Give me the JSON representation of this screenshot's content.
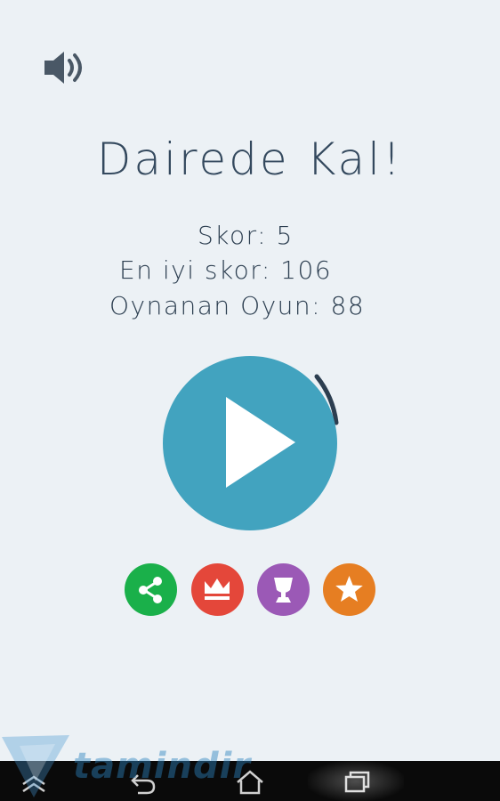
{
  "game": {
    "title": "Dairede Kal!",
    "score_label": "Skor: 5",
    "best_label": "En iyi skor: 106",
    "played_label": "Oynanan Oyun: 88"
  },
  "buttons": {
    "sound_icon": "speaker-icon",
    "play_icon": "play-icon",
    "share_icon": "share-icon",
    "crown_icon": "crown-icon",
    "trophy_icon": "trophy-icon",
    "star_icon": "star-icon"
  },
  "colors": {
    "background": "#ecf1f5",
    "play": "#42a3bf",
    "share": "#1ab04a",
    "crown": "#e4473a",
    "trophy": "#9b59b6",
    "star": "#e67e22"
  },
  "watermark": {
    "text": "tamindir"
  },
  "navbar": {
    "icons": [
      "menu-up-icon",
      "back-icon",
      "home-icon",
      "recent-apps-icon"
    ]
  }
}
